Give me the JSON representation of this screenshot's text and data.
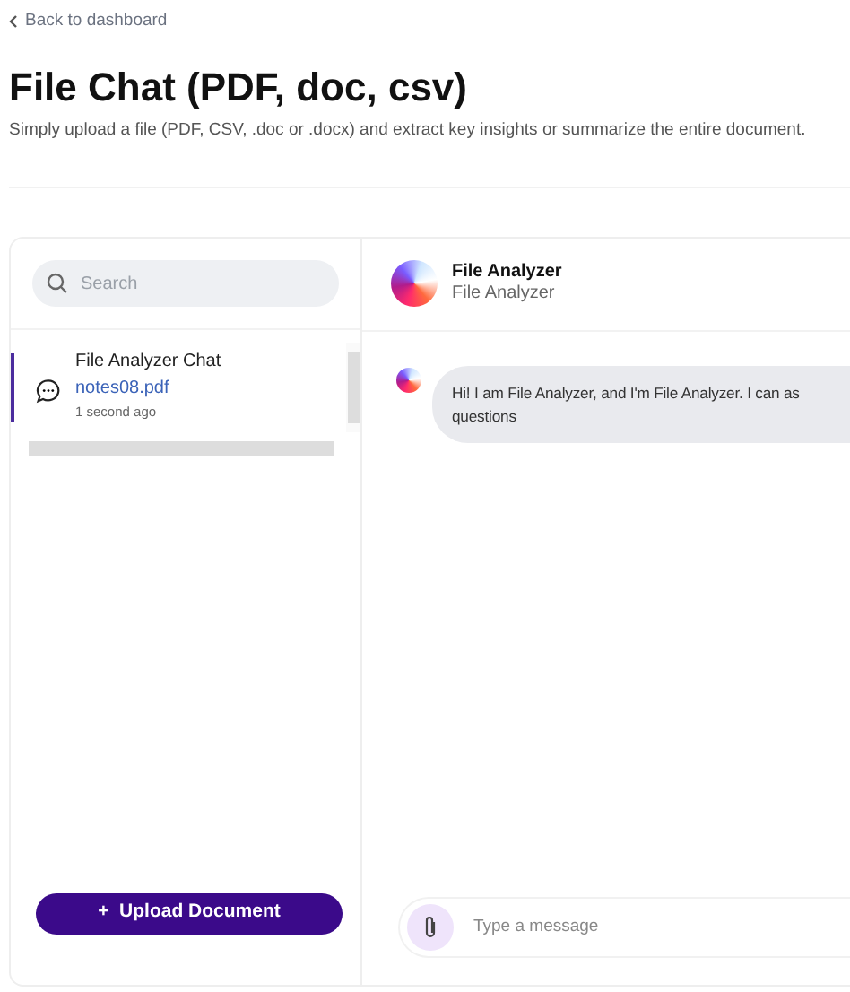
{
  "back_link": {
    "label": "Back to dashboard"
  },
  "title": "File Chat (PDF, doc, csv)",
  "subtitle": "Simply upload a file (PDF, CSV, .doc or .docx) and extract key insights or summarize the entire document.",
  "sidebar": {
    "search": {
      "placeholder": "Search"
    },
    "chats": [
      {
        "title": "File Analyzer Chat",
        "file": "notes08.pdf",
        "time": "1 second ago",
        "selected": true
      }
    ],
    "upload_button": "Upload Document",
    "upload_icon": "+"
  },
  "chat": {
    "header": {
      "name": "File Analyzer",
      "subtitle": "File Analyzer"
    },
    "messages": [
      {
        "lines": [
          "Hi! I am File Analyzer, and I'm File Analyzer. I can as",
          "questions"
        ]
      }
    ],
    "input": {
      "placeholder": "Type a message"
    }
  }
}
